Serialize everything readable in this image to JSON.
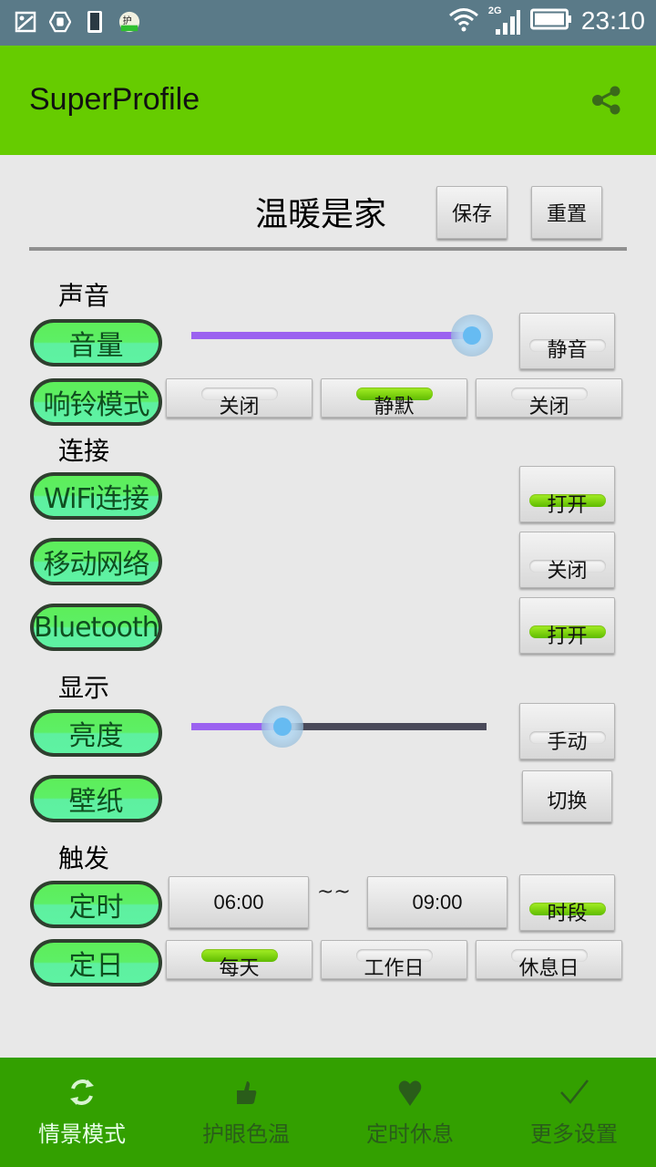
{
  "status_bar": {
    "left_icons": [
      "gallery-icon",
      "hand-block-icon",
      "phone-icon",
      "eye-care-app-icon"
    ],
    "network_type": "2G",
    "time": "23:10"
  },
  "app_bar": {
    "title": "SuperProfile",
    "action_icon": "share-icon",
    "color": "#66cc00"
  },
  "profile": {
    "name": "温暖是家",
    "save_label": "保存",
    "reset_label": "重置"
  },
  "sections": {
    "sound": {
      "title": "声音",
      "volume": {
        "label": "音量",
        "level_percent": 95,
        "mute_label": "静音",
        "mute_on": false
      },
      "ringer": {
        "label": "响铃模式",
        "options": [
          {
            "label": "关闭",
            "on": false
          },
          {
            "label": "静默",
            "on": true
          },
          {
            "label": "关闭",
            "on": false
          }
        ]
      }
    },
    "connection": {
      "title": "连接",
      "wifi": {
        "label": "WiFi连接",
        "state_label": "打开",
        "on": true
      },
      "mobile": {
        "label": "移动网络",
        "state_label": "关闭",
        "on": false
      },
      "bluetooth": {
        "label": "Bluetooth",
        "state_label": "打开",
        "on": true
      }
    },
    "display": {
      "title": "显示",
      "brightness": {
        "label": "亮度",
        "level_percent": 31,
        "mode_label": "手动",
        "mode_on": false
      },
      "wallpaper": {
        "label": "壁纸",
        "action_label": "切换"
      }
    },
    "trigger": {
      "title": "触发",
      "timer": {
        "label": "定时",
        "start": "06:00",
        "separator": "~~",
        "end": "09:00",
        "mode_label": "时段",
        "mode_on": true
      },
      "days": {
        "label": "定日",
        "options": [
          {
            "label": "每天",
            "on": true
          },
          {
            "label": "工作日",
            "on": false
          },
          {
            "label": "休息日",
            "on": false
          }
        ]
      }
    }
  },
  "bottom_nav": {
    "items": [
      {
        "label": "情景模式",
        "icon": "refresh-icon",
        "active": true
      },
      {
        "label": "护眼色温",
        "icon": "thumbs-up-icon",
        "active": false
      },
      {
        "label": "定时休息",
        "icon": "heart-icon",
        "active": false
      },
      {
        "label": "更多设置",
        "icon": "checkmark-icon",
        "active": false
      }
    ]
  }
}
